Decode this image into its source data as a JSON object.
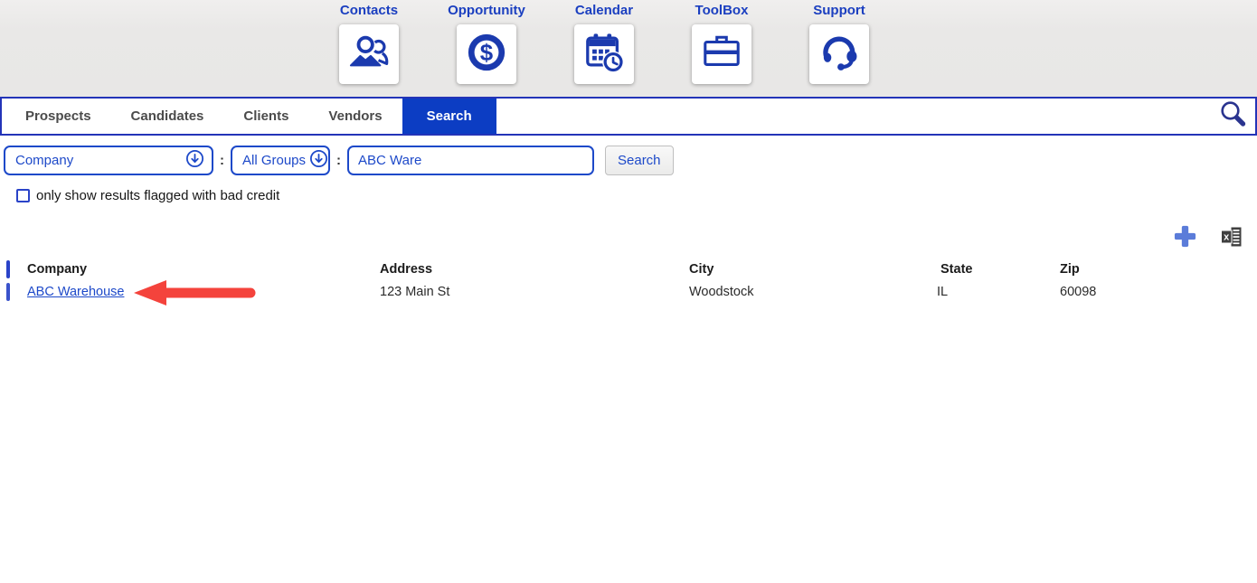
{
  "toolbar": {
    "items": [
      {
        "label": "Contacts",
        "icon": "contacts-icon"
      },
      {
        "label": "Opportunity",
        "icon": "opportunity-dollar-icon"
      },
      {
        "label": "Calendar",
        "icon": "calendar-clock-icon"
      },
      {
        "label": "ToolBox",
        "icon": "toolbox-briefcase-icon"
      },
      {
        "label": "Support",
        "icon": "support-headset-icon"
      }
    ]
  },
  "tabs": {
    "items": [
      {
        "label": "Prospects",
        "active": false
      },
      {
        "label": "Candidates",
        "active": false
      },
      {
        "label": "Clients",
        "active": false
      },
      {
        "label": "Vendors",
        "active": false
      },
      {
        "label": "Search",
        "active": true
      }
    ]
  },
  "filters": {
    "field_dropdown_value": "Company",
    "separator": ":",
    "group_dropdown_value": "All Groups",
    "query_value": "ABC Ware",
    "search_button_label": "Search",
    "bad_credit_label": "only show results flagged with bad credit",
    "bad_credit_checked": false
  },
  "results": {
    "columns": {
      "company": "Company",
      "address": "Address",
      "city": "City",
      "state": "State",
      "zip": "Zip"
    },
    "rows": [
      {
        "company": "ABC Warehouse",
        "address": "123 Main St",
        "city": "Woodstock",
        "state": "IL",
        "zip": "60098"
      }
    ]
  },
  "annotation": {
    "shape": "red-arrow",
    "points_to": "ABC Warehouse"
  },
  "colors": {
    "header_gray": "#e9e8e7",
    "accent_blue": "#0c3dc3",
    "icon_blue": "#1b3aae",
    "control_blue": "#1d49c9",
    "tab_text_gray": "#4b4b4b",
    "arrow_red": "#f4433c",
    "add_plus_blue": "#5b7cd9",
    "excel_gray": "#3f3f3f"
  }
}
